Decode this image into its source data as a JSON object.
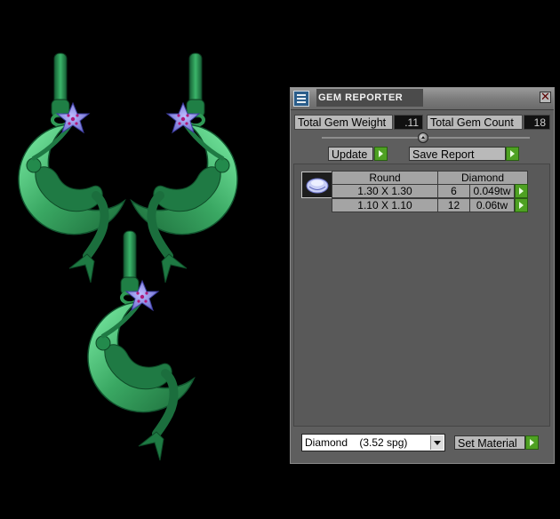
{
  "window": {
    "title": "GEM REPORTER",
    "close_glyph": "✕"
  },
  "stats": {
    "weight_label": "Total Gem Weight",
    "weight_value": ".11",
    "count_label": "Total Gem Count",
    "count_value": "18"
  },
  "actions": {
    "update_label": "Update",
    "save_report_label": "Save Report",
    "set_material_label": "Set Material"
  },
  "gem_table": {
    "headers": [
      "Round",
      "Diamond"
    ],
    "rows": [
      {
        "size": "1.30 X 1.30",
        "count": "6",
        "weight": "0.049tw"
      },
      {
        "size": "1.10 X 1.10",
        "count": "12",
        "weight": "0.06tw"
      }
    ]
  },
  "material": {
    "selected": "Diamond    (3.52 spg)"
  },
  "icons": {
    "app_logo": "gem-reporter-logo-icon",
    "gem": "round-gem-icon",
    "go": "green-play-arrow-icon"
  },
  "colors": {
    "background": "#000000",
    "panel": "#5e5e5e",
    "jewelry_green": "#2f9a55",
    "gem_stone": "#8e8ee0",
    "go_button": "#4ea122"
  }
}
